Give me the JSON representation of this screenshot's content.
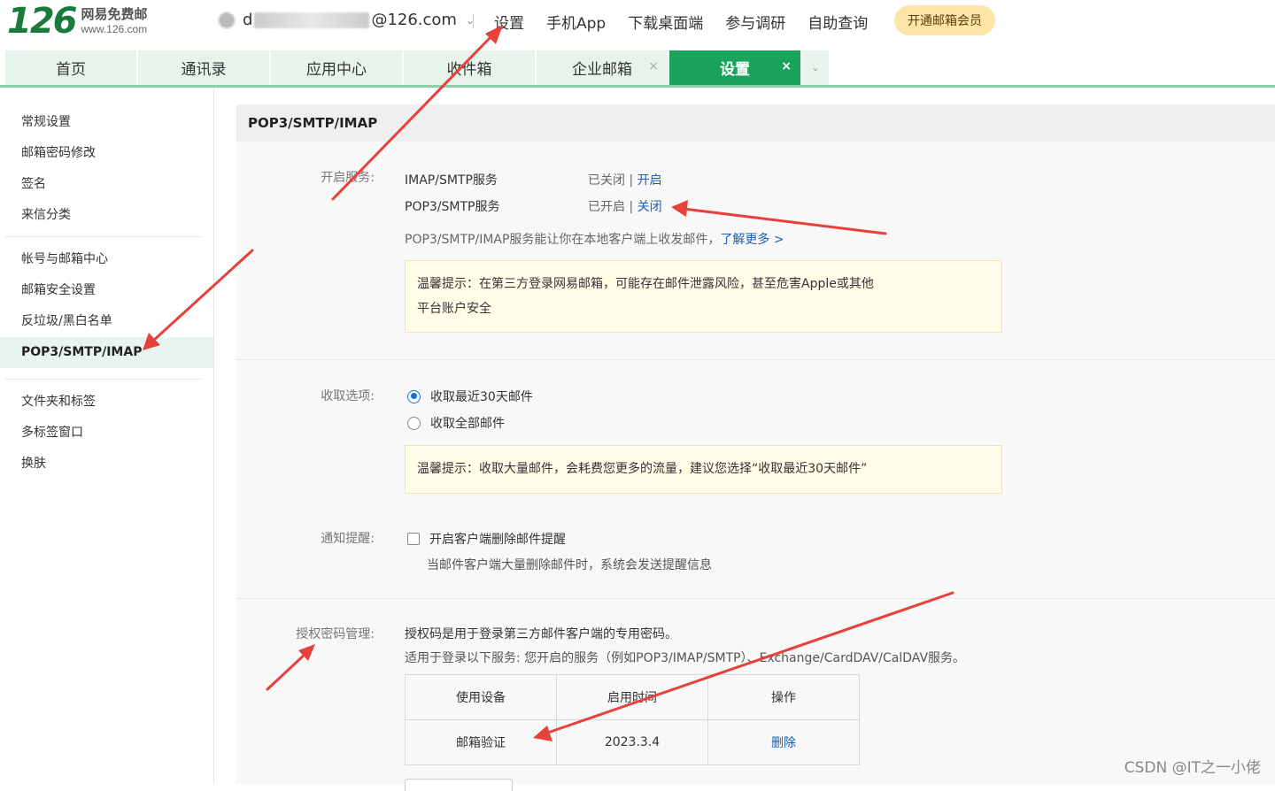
{
  "header": {
    "logo_number": "126",
    "logo_name": "网易免费邮",
    "logo_url": "www.126.com",
    "account_prefix": "d",
    "account_suffix": "@126.com",
    "nav": [
      "设置",
      "手机App",
      "下载桌面端",
      "参与调研",
      "自助查询"
    ],
    "vip_button": "开通邮箱会员"
  },
  "tabs": [
    {
      "label": "首页"
    },
    {
      "label": "通讯录"
    },
    {
      "label": "应用中心"
    },
    {
      "label": "收件箱"
    },
    {
      "label": "企业邮箱",
      "close": "×"
    },
    {
      "label": "设置",
      "close": "×",
      "active": true
    }
  ],
  "sidebar": {
    "group1": [
      "常规设置",
      "邮箱密码修改",
      "签名",
      "来信分类"
    ],
    "group2": [
      "帐号与邮箱中心",
      "邮箱安全设置",
      "反垃圾/黑白名单",
      "POP3/SMTP/IMAP"
    ],
    "group3": [
      "文件夹和标签",
      "多标签窗口",
      "换肤"
    ]
  },
  "main": {
    "title": "POP3/SMTP/IMAP",
    "services_label": "开启服务:",
    "services": [
      {
        "name": "IMAP/SMTP服务",
        "status": "已关闭",
        "sep": " | ",
        "action": "开启"
      },
      {
        "name": "POP3/SMTP服务",
        "status": "已开启",
        "sep": " | ",
        "action": "关闭"
      }
    ],
    "services_hint": "POP3/SMTP/IMAP服务能让你在本地客户端上收发邮件，",
    "learn_more": "了解更多 >",
    "warning1_line1": "温馨提示：在第三方登录网易邮箱，可能存在邮件泄露风险，甚至危害Apple或其他",
    "warning1_line2": "平台账户安全",
    "receive_label": "收取选项:",
    "receive_options": [
      "收取最近30天邮件",
      "收取全部邮件"
    ],
    "warning2": "温馨提示：收取大量邮件，会耗费您更多的流量，建议您选择“收取最近30天邮件”",
    "notify_label": "通知提醒:",
    "notify_option": "开启客户端删除邮件提醒",
    "notify_desc": "当邮件客户端大量删除邮件时，系统会发送提醒信息",
    "auth_label": "授权密码管理:",
    "auth_desc1": "授权码是用于登录第三方邮件客户端的专用密码。",
    "auth_desc2": "适用于登录以下服务: 您开启的服务（例如POP3/IMAP/SMTP）、Exchange/CardDAV/CalDAV服务。",
    "auth_table": {
      "headers": [
        "使用设备",
        "启用时间",
        "操作"
      ],
      "rows": [
        [
          "邮箱验证",
          "2023.3.4",
          "删除"
        ]
      ]
    }
  },
  "watermark": "CSDN @IT之一小佬",
  "colors": {
    "brand_green": "#1aa35b",
    "link_blue": "#1a5fb4",
    "arrow_red": "#e8403a"
  }
}
